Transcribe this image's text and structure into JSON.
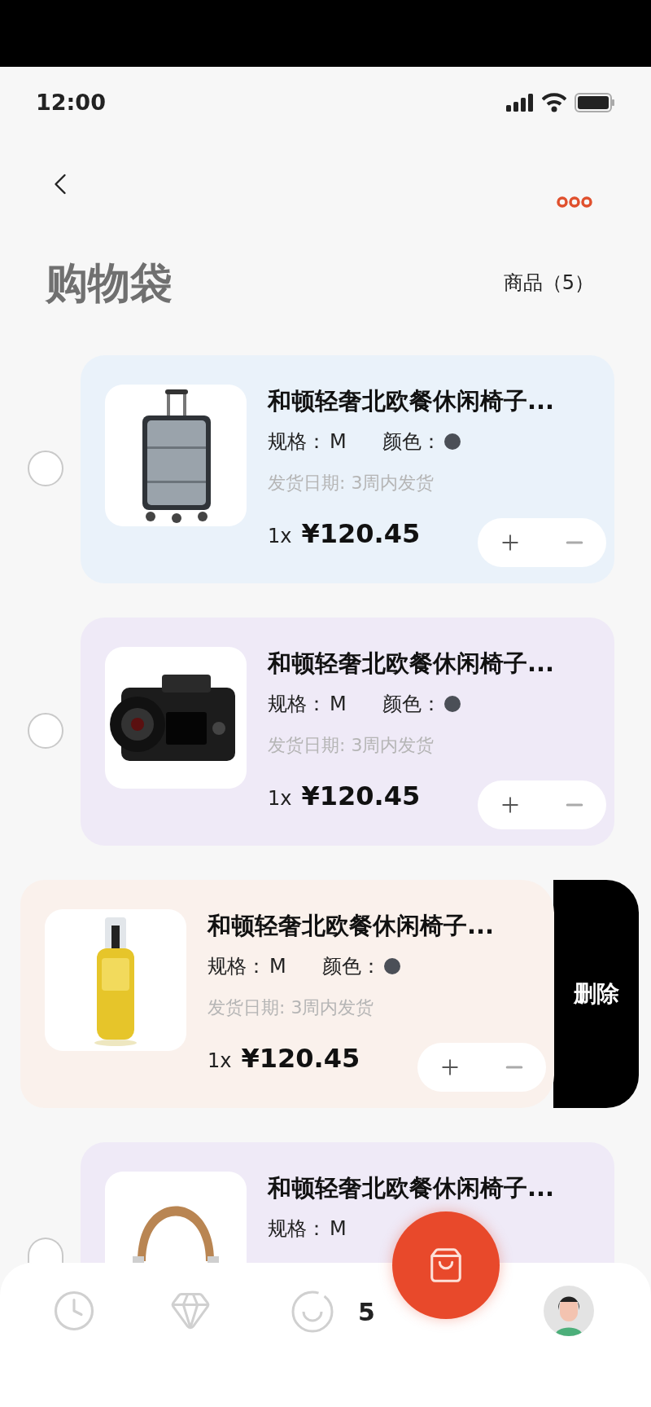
{
  "status_bar": {
    "time": "12:00"
  },
  "header": {
    "title": "购物袋",
    "count": "商品（5）"
  },
  "items": [
    {
      "title": "和顿轻奢北欧餐休闲椅子...",
      "spec_label": "规格：",
      "spec_value": "M",
      "color_label": "颜色：",
      "color": "#4b4f57",
      "date": "发货日期: 3周内发货",
      "quantity": "1x",
      "price": "¥120.45",
      "selected": false,
      "swiped": false
    },
    {
      "title": "和顿轻奢北欧餐休闲椅子...",
      "spec_label": "规格：",
      "spec_value": "M",
      "color_label": "颜色：",
      "color": "#4b4f57",
      "date": "发货日期: 3周内发货",
      "quantity": "1x",
      "price": "¥120.45",
      "selected": false,
      "swiped": false
    },
    {
      "title": "和顿轻奢北欧餐休闲椅子...",
      "spec_label": "规格：",
      "spec_value": "M",
      "color_label": "颜色：",
      "color": "#4b4f57",
      "date": "发货日期: 3周内发货",
      "quantity": "1x",
      "price": "¥120.45",
      "swiped": true,
      "delete_label": "删除"
    },
    {
      "title": "和顿轻奢北欧餐休闲椅子...",
      "spec_label": "规格：",
      "spec_value": "M",
      "selected": false,
      "swiped": false
    }
  ],
  "tab_bar": {
    "cart_count": "5"
  }
}
